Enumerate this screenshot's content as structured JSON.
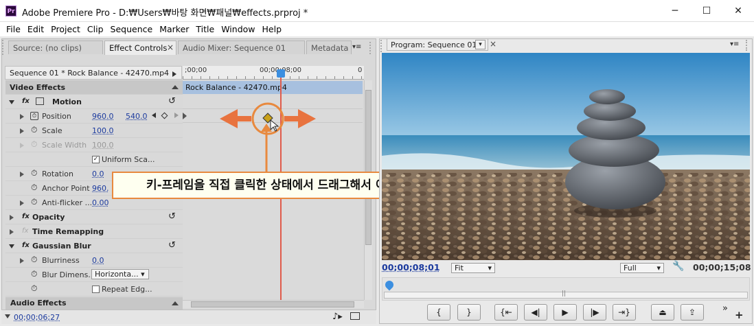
{
  "titlebar": {
    "app_icon_text": "Pr",
    "title": "Adobe Premiere Pro - D:₩Users₩바탕 화면₩패널₩effects.prproj *",
    "minimize": "─",
    "maximize": "☐",
    "close": "✕"
  },
  "menu": [
    "File",
    "Edit",
    "Project",
    "Clip",
    "Sequence",
    "Marker",
    "Title",
    "Window",
    "Help"
  ],
  "left_tabs": [
    {
      "label": "Source: (no clips)"
    },
    {
      "label": "Effect Controls",
      "close": "×"
    },
    {
      "label": "Audio Mixer: Sequence 01"
    },
    {
      "label": "Metadata"
    }
  ],
  "tab_menu_icon": "▾≡",
  "effect_controls": {
    "header": "Sequence 01 * Rock Balance - 42470.mp4",
    "ruler_start": ";00;00",
    "ruler_mid": "00;00;08;00",
    "ruler_end": "0",
    "clip_label": "Rock Balance - 42470.mp4",
    "video_effects": "Video Effects",
    "audio_effects": "Audio Effects",
    "motion": "Motion",
    "position": {
      "label": "Position",
      "x": "960.0",
      "y": "540.0"
    },
    "scale": {
      "label": "Scale",
      "value": "100.0"
    },
    "scale_width": {
      "label": "Scale Width",
      "value": "100.0"
    },
    "uniform_scale": "Uniform Sca...",
    "rotation": {
      "label": "Rotation",
      "value": "0.0"
    },
    "anchor_point": {
      "label": "Anchor Point",
      "value": "960."
    },
    "anti_flicker": {
      "label": "Anti-flicker ...",
      "value": "0.00"
    },
    "opacity": "Opacity",
    "time_remapping": "Time Remapping",
    "gaussian_blur": "Gaussian Blur",
    "blurriness": {
      "label": "Blurriness",
      "value": "0.0"
    },
    "blur_dimensions": {
      "label": "Blur Dimens...",
      "value": "Horizonta..."
    },
    "repeat_edge": "Repeat Edg...",
    "fx": "fx",
    "footer_time": "00;00;06;27"
  },
  "callout": {
    "text": "키-프레임을 직접 클릭한 상태에서 드래그해서 이동"
  },
  "program_monitor": {
    "tab_label": "Program: Sequence 01",
    "current_time": "00;00;08;01",
    "fit": "Fit",
    "quality": "Full",
    "duration": "00;00;15;08"
  },
  "colors": {
    "accent": "#e8893e",
    "timecode": "#1b3a9e",
    "playhead": "#e05b4b"
  }
}
